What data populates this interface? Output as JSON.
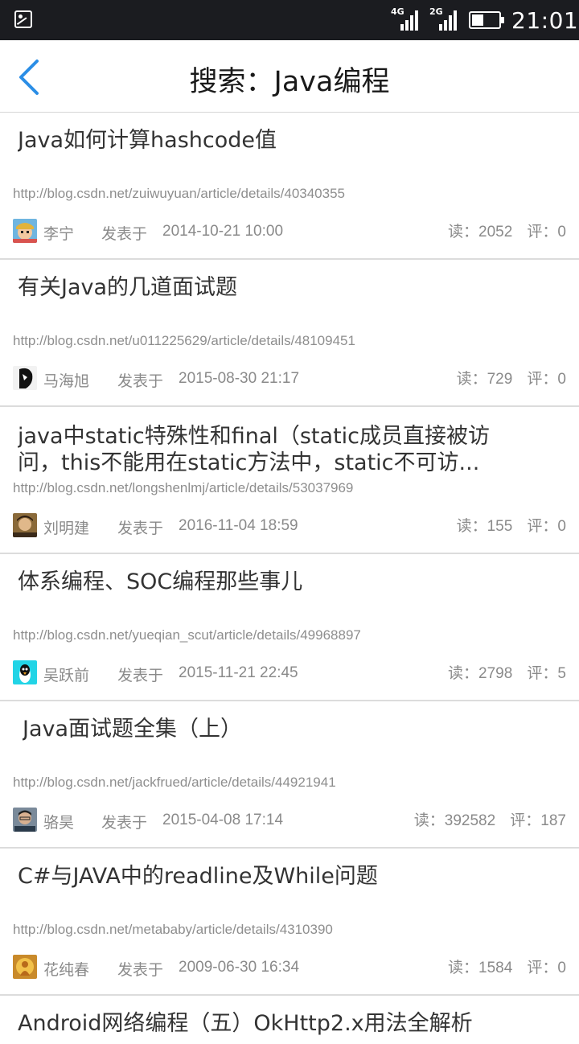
{
  "status_bar": {
    "time": "21:01",
    "signal1": "4G",
    "signal2": "2G"
  },
  "header": {
    "title": "搜索：Java编程"
  },
  "labels": {
    "published": "发表于",
    "reads": "读：",
    "comments": "评："
  },
  "results": [
    {
      "title": "Java如何计算hashcode值",
      "url": "http://blog.csdn.net/zuiwuyuan/article/details/40340355",
      "author": "李宁",
      "date": "2014-10-21 10:00",
      "reads": "2052",
      "comments": "0"
    },
    {
      "title": "有关Java的几道面试题",
      "url": "http://blog.csdn.net/u011225629/article/details/48109451",
      "author": "马海旭",
      "date": "2015-08-30 21:17",
      "reads": "729",
      "comments": "0"
    },
    {
      "title": "java中static特殊性和final（static成员直接被访问，this不能用在static方法中，static不可访...",
      "url": "http://blog.csdn.net/longshenlmj/article/details/53037969",
      "author": "刘明建",
      "date": "2016-11-04 18:59",
      "reads": "155",
      "comments": "0"
    },
    {
      "title": "体系编程、SOC编程那些事儿",
      "url": "http://blog.csdn.net/yueqian_scut/article/details/49968897",
      "author": "吴跃前",
      "date": "2015-11-21 22:45",
      "reads": "2798",
      "comments": "5"
    },
    {
      "title": "Java面试题全集（上）",
      "url": "http://blog.csdn.net/jackfrued/article/details/44921941",
      "author": "骆昊",
      "date": "2015-04-08 17:14",
      "reads": "392582",
      "comments": "187"
    },
    {
      "title": "C#与JAVA中的readline及While问题",
      "url": "http://blog.csdn.net/metababy/article/details/4310390",
      "author": "花纯春",
      "date": "2009-06-30 16:34",
      "reads": "1584",
      "comments": "0"
    },
    {
      "title": "Android网络编程（五）OkHttp2.x用法全解析"
    }
  ]
}
